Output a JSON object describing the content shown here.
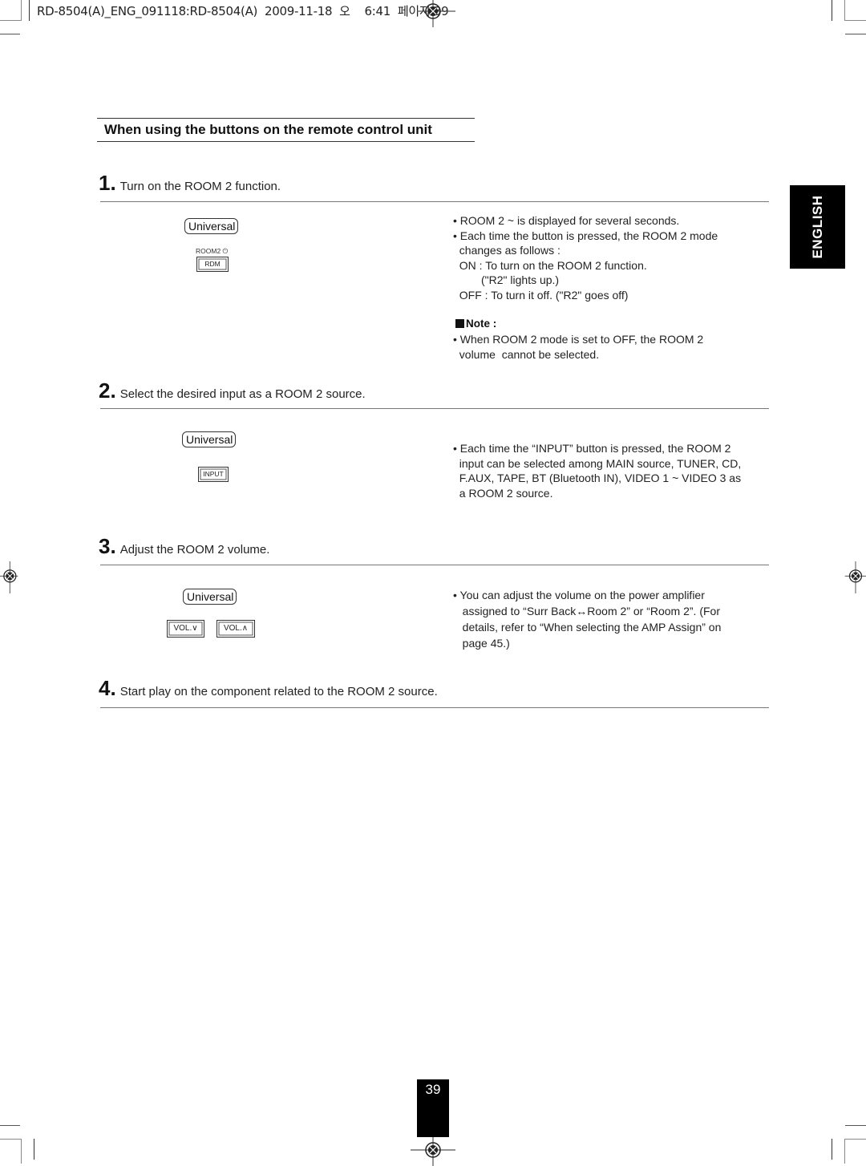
{
  "print_slug": {
    "text": "RD-8504(A)_ENG_091118:RD-8504(A)  2009-11-18  오    6:41  페이지 39"
  },
  "section_title": "When using the buttons on the remote control unit",
  "language_tab": "ENGLISH",
  "steps": [
    {
      "number": "1.",
      "text": "Turn on the ROOM 2 function.",
      "mode_label": "Universal",
      "button_caption": "ROOM2 ⏻",
      "buttons": [
        "RDM"
      ],
      "notes": "• ROOM 2 ~ is displayed for several seconds.\n• Each time the button is pressed, the ROOM 2 mode\n  changes as follows :\n  ON : To turn on the ROOM 2 function.\n         (\"R2\" lights up.)\n  OFF : To turn it off. (\"R2\" goes off)",
      "note_heading": "Note :",
      "note_body": "• When ROOM 2 mode is set to OFF, the ROOM 2\n  volume  cannot be selected."
    },
    {
      "number": "2.",
      "text": "Select the desired input as a ROOM 2 source.",
      "mode_label": "Universal",
      "buttons": [
        "INPUT"
      ],
      "notes": "• Each time the “INPUT” button is pressed, the ROOM 2\n  input can be selected among MAIN source, TUNER, CD,\n  F.AUX, TAPE, BT (Bluetooth IN), VIDEO 1 ~ VIDEO 3 as\n  a ROOM 2 source."
    },
    {
      "number": "3.",
      "text": "Adjust the ROOM 2 volume.",
      "mode_label": "Universal",
      "buttons": [
        "VOL.∨",
        "VOL.∧"
      ],
      "notes": "• You can adjust the volume on the power amplifier\n   assigned to “Surr Back↔Room 2” or “Room 2”. (For\n   details, refer to “When selecting the AMP Assign” on\n   page 45.)"
    },
    {
      "number": "4.",
      "text": "Start play on the component related to the ROOM 2 source."
    }
  ],
  "page_number": "39"
}
